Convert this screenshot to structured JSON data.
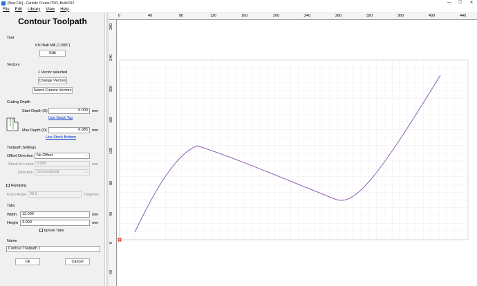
{
  "window": {
    "title": "[New File] - Carbide Create PRO, Build 812",
    "controls": {
      "minimize": "—",
      "maximize": "☐",
      "close": "✕"
    }
  },
  "menu": {
    "file": "File",
    "edit": "Edit",
    "library": "Library",
    "view": "View",
    "help": "Help"
  },
  "panel": {
    "title": "Contour Toolpath",
    "tool": {
      "section": "Tool",
      "name": "#10 Ball Mill (1.000\")",
      "edit_button": "Edit"
    },
    "vectors": {
      "section": "Vectors",
      "status": "1 Vector selected",
      "change_button": "Change Vectors",
      "select_button": "Select Current Vectors"
    },
    "cutting_depth": {
      "section": "Cutting Depth",
      "start_label": "Start Depth (S)",
      "start_value": "0.000",
      "start_unit": "mm",
      "stock_top_link": "Use Stock Top",
      "max_label": "Max Depth (D)",
      "max_value": "6.985",
      "max_unit": "mm",
      "stock_bottom_link": "Use Stock Bottom"
    },
    "toolpath_settings": {
      "section": "Toolpath Settings",
      "offset_label": "Offset Direction",
      "offset_value": "No Offset",
      "stock_label": "Stock to Leave",
      "stock_value": "0.000",
      "stock_unit": "mm",
      "direction_label": "Direction",
      "direction_value": "Conventional"
    },
    "ramping": {
      "label": "Ramping",
      "angle_label": "Entry Angle",
      "angle_value": "20.0",
      "angle_unit": "Degrees"
    },
    "tabs": {
      "section": "Tabs",
      "width_label": "Width",
      "width_value": "12.000",
      "width_unit": "mm",
      "height_label": "Height",
      "height_value": "3.000",
      "height_unit": "mm",
      "ignore_label": "Ignore Tabs"
    },
    "name": {
      "section": "Name",
      "value": "Contour Toolpath 1"
    },
    "ok_button": "Ok",
    "cancel_button": "Cancel"
  },
  "ruler_x": [
    "0",
    "40",
    "80",
    "120",
    "160",
    "200",
    "240",
    "280",
    "320",
    "360",
    "400",
    "440"
  ],
  "ruler_y": [
    "280",
    "240",
    "200",
    "160",
    "120",
    "80",
    "40",
    "0",
    "-40"
  ]
}
